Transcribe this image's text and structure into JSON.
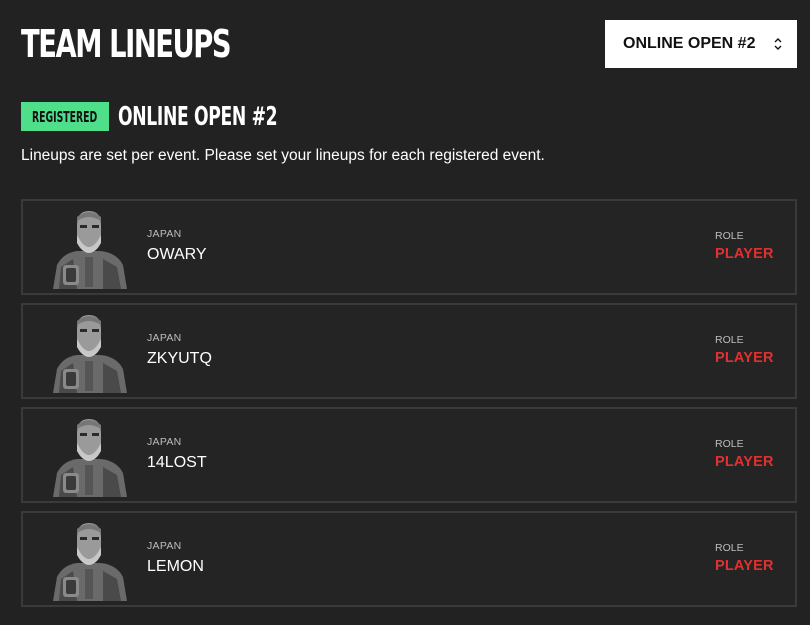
{
  "header": {
    "title": "TEAM LINEUPS"
  },
  "event_select": {
    "value": "ONLINE OPEN #2",
    "chevron_icon": "up-down-chevron-icon"
  },
  "event": {
    "badge": "REGISTERED",
    "badge_color": "#4fdf8a",
    "name": "ONLINE OPEN #2",
    "description": "Lineups are set per event. Please set your lineups for each registered event."
  },
  "role_color": "#e03131",
  "players": [
    {
      "country": "JAPAN",
      "name": "OWARY",
      "role_label": "ROLE",
      "role": "PLAYER",
      "avatar_icon": "character-portrait-icon"
    },
    {
      "country": "JAPAN",
      "name": "ZKYUTQ",
      "role_label": "ROLE",
      "role": "PLAYER",
      "avatar_icon": "character-portrait-icon"
    },
    {
      "country": "JAPAN",
      "name": "14LOST",
      "role_label": "ROLE",
      "role": "PLAYER",
      "avatar_icon": "character-portrait-icon"
    },
    {
      "country": "JAPAN",
      "name": "LEMON",
      "role_label": "ROLE",
      "role": "PLAYER",
      "avatar_icon": "character-portrait-icon"
    }
  ]
}
